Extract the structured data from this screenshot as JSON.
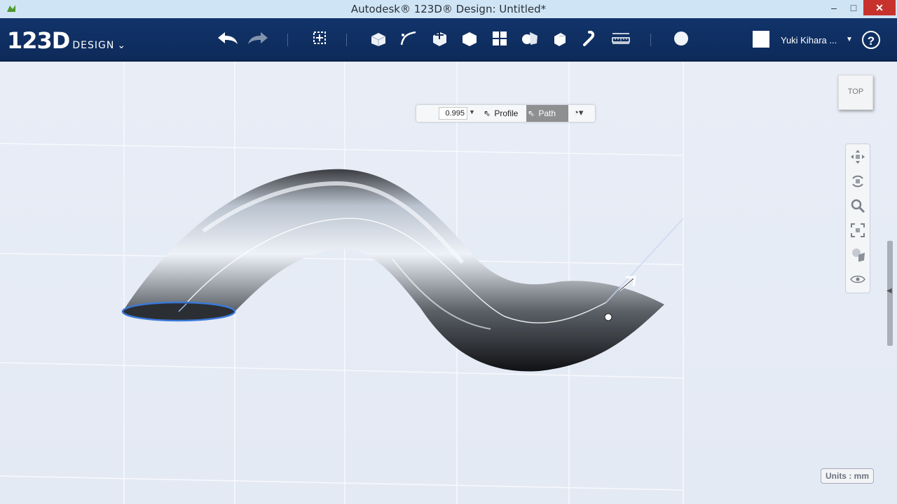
{
  "window": {
    "title": "Autodesk® 123D® Design: Untitled*",
    "minimize": "–",
    "maximize": "□",
    "close": "✕"
  },
  "app": {
    "logo_big": "123D",
    "logo_small": "DESIGN",
    "logo_chevron": "⌄"
  },
  "toolbar": {
    "tools": [
      "undo-icon",
      "redo-icon",
      "transform-icon",
      "primitives-icon",
      "sketch-icon",
      "construct-icon",
      "modify-icon",
      "pattern-icon",
      "grouping-icon",
      "combine-icon",
      "snap-icon",
      "measure-icon",
      "material-icon"
    ]
  },
  "user": {
    "name": "Yuki Kihara ...",
    "dropdown": "▼",
    "help": "?"
  },
  "context_menu": {
    "value": "0.995",
    "profile_label": "Profile",
    "path_label": "Path"
  },
  "viewcube": {
    "face_label": "TOP"
  },
  "navbar": {
    "tools": [
      "pan-icon",
      "orbit-icon",
      "zoom-icon",
      "fit-icon",
      "view-mode-icon",
      "visibility-icon"
    ]
  },
  "status": {
    "units": "Units : mm"
  },
  "colors": {
    "toolbar_bg": "#0d2a59",
    "titlebar_bg": "#cfe5f6",
    "close_red": "#c7332c",
    "path_active": "#8e8f91",
    "profile_outline": "#3b78d8"
  }
}
